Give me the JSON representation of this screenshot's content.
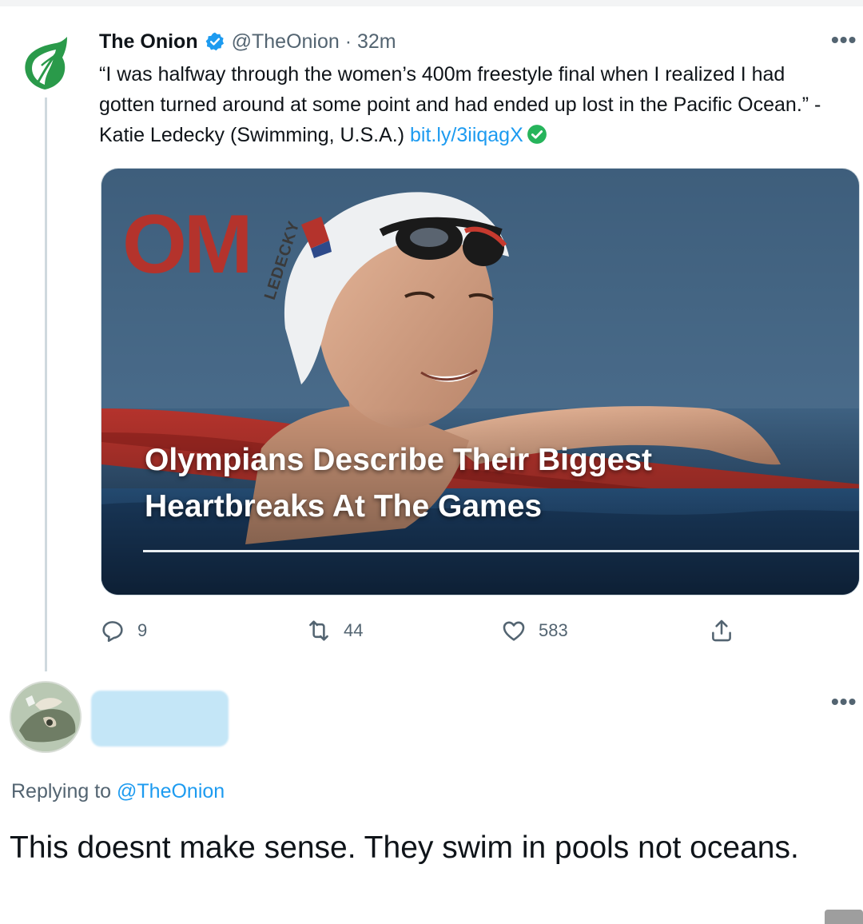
{
  "tweet": {
    "display_name": "The Onion",
    "handle": "@TheOnion",
    "separator": " · ",
    "time": "32m",
    "text": "“I was halfway through the women’s 400m freestyle final when I realized I had gotten turned around at some point and had ended up lost in the Pacific Ocean.” -Katie Ledecky (Swimming, U.S.A.) ",
    "link": "bit.ly/3iiqagX",
    "media": {
      "headline": "Olympians Describe Their Biggest Heartbreaks At The Games",
      "cap_text": "LEDECKY",
      "background_letters": "OM"
    },
    "actions": {
      "replies": "9",
      "retweets": "44",
      "likes": "583"
    }
  },
  "reply": {
    "replying_prefix": "Replying to ",
    "replying_mention": "@TheOnion",
    "text": "This doesnt make sense. They swim in pools not oceans."
  },
  "more_icon": "•••",
  "colors": {
    "brand_green": "#2a9a4a",
    "verified_blue": "#1d9bf0",
    "link_blue": "#1d9bf0",
    "muted": "#536471",
    "redaction": "#c4e6f7"
  }
}
